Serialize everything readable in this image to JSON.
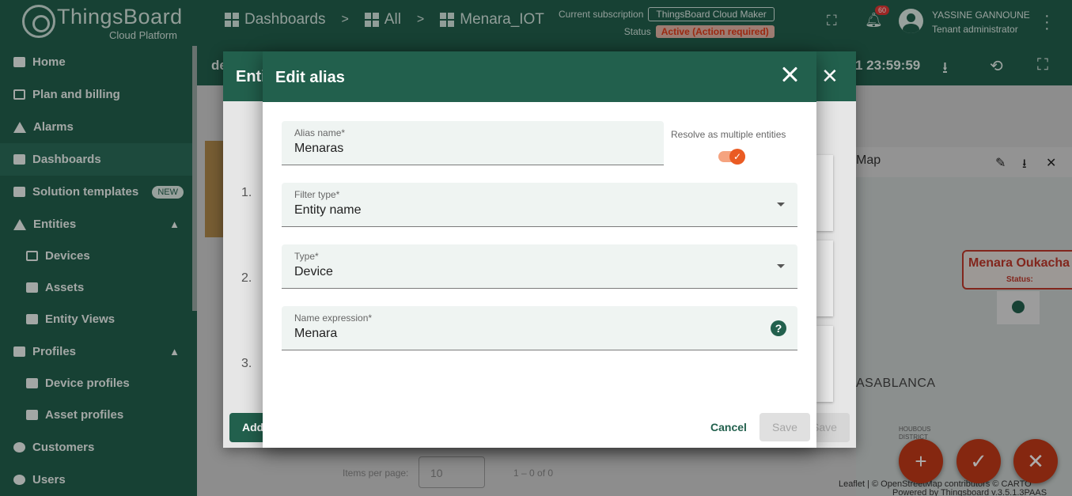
{
  "topbar": {
    "brand": "ThingsBoard",
    "brand_sub": "Cloud Platform",
    "breadcrumbs": [
      "Dashboards",
      "All",
      "Menara_IOT"
    ],
    "separator": ">",
    "subscription_label": "Current subscription",
    "subscription_value": "ThingsBoard Cloud Maker",
    "status_label": "Status",
    "status_value": "Active (Action required)",
    "notifications_count": "60",
    "user_name": "YASSINE GANNOUNE",
    "user_role": "Tenant administrator"
  },
  "sidebar": {
    "items": [
      {
        "label": "Home"
      },
      {
        "label": "Plan and billing"
      },
      {
        "label": "Alarms"
      },
      {
        "label": "Dashboards"
      },
      {
        "label": "Solution templates",
        "badge": "NEW"
      },
      {
        "label": "Entities"
      },
      {
        "label": "Devices"
      },
      {
        "label": "Assets"
      },
      {
        "label": "Entity Views"
      },
      {
        "label": "Profiles"
      },
      {
        "label": "Device profiles"
      },
      {
        "label": "Asset profiles"
      },
      {
        "label": "Customers"
      },
      {
        "label": "Users"
      }
    ]
  },
  "dashboard": {
    "header_left": "de",
    "time_fragment": "1 23:59:59",
    "map_title": "Map",
    "map_city": "ASABLANCA",
    "marker_name": "Menara Oukacha",
    "marker_status": "Status:",
    "district": "HOUBOUS DISTRICT",
    "attribution": "Leaflet | © OpenStreetMap contributors © CARTO",
    "powered": "Powered by Thingsboard v.3.5.1.3PAAS",
    "items_per_page_label": "Items per page:",
    "items_per_page_value": "10",
    "pager_count": "1 – 0 of 0"
  },
  "outer_dialog": {
    "title": "Enti",
    "row_numbers": [
      "1.",
      "2.",
      "3."
    ],
    "add_label": "Add",
    "save_label": "Save"
  },
  "dialog": {
    "title": "Edit alias",
    "alias_name_label": "Alias name*",
    "alias_name_value": "Menaras",
    "resolve_label": "Resolve as multiple entities",
    "resolve_checked": true,
    "filter_type_label": "Filter type*",
    "filter_type_value": "Entity name",
    "type_label": "Type*",
    "type_value": "Device",
    "name_expression_label": "Name expression*",
    "name_expression_value": "Menara",
    "cancel_label": "Cancel",
    "save_label": "Save"
  },
  "colors": {
    "primary": "#22604d",
    "accent": "#ea5b23",
    "status_text": "#e53d1a"
  }
}
